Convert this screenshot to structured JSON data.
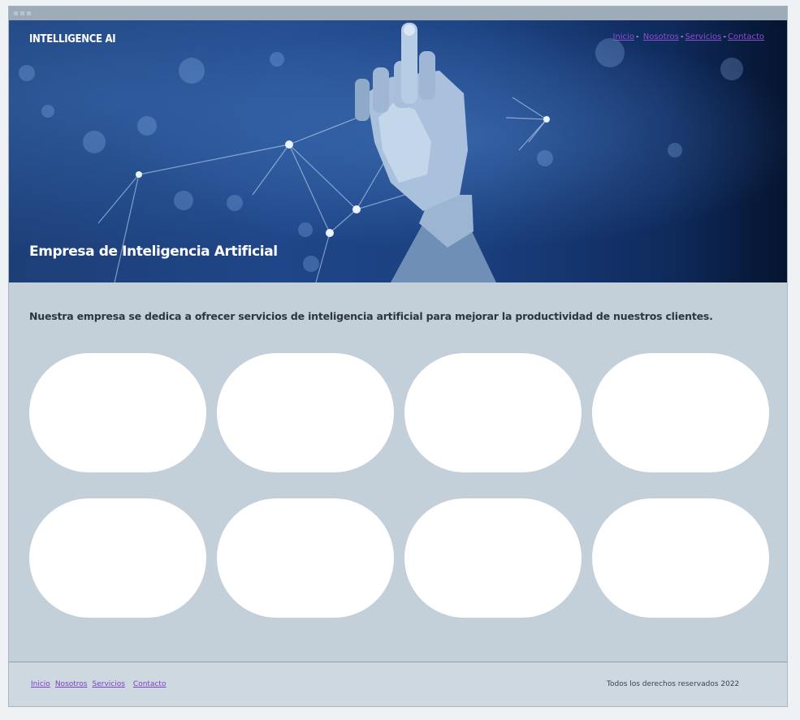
{
  "header": {
    "brand": "INTELLIGENCE AI",
    "nav": [
      {
        "label": "Inicio"
      },
      {
        "label": "Nosotros"
      },
      {
        "label": "Servicios"
      },
      {
        "label": "Contacto"
      }
    ],
    "separator": "-"
  },
  "hero": {
    "title": "Empresa de Inteligencia Artificial",
    "image": "robot-hand-network-illustration"
  },
  "main": {
    "intro": "Nuestra empresa se dedica a ofrecer servicios de inteligencia artificial para mejorar la productividad de nuestros clientes.",
    "cards_count_label": ""
  },
  "footer": {
    "nav": [
      {
        "label": "Inicio"
      },
      {
        "label": "Nosotros"
      },
      {
        "label": "Servicios"
      },
      {
        "label": "Contacto"
      }
    ],
    "copyright": "Todos los derechos reservados 2022"
  },
  "colors": {
    "page_bg": "#c3cfd9",
    "link": "#8b4fd0",
    "footer_bg": "#cdd8e1"
  }
}
